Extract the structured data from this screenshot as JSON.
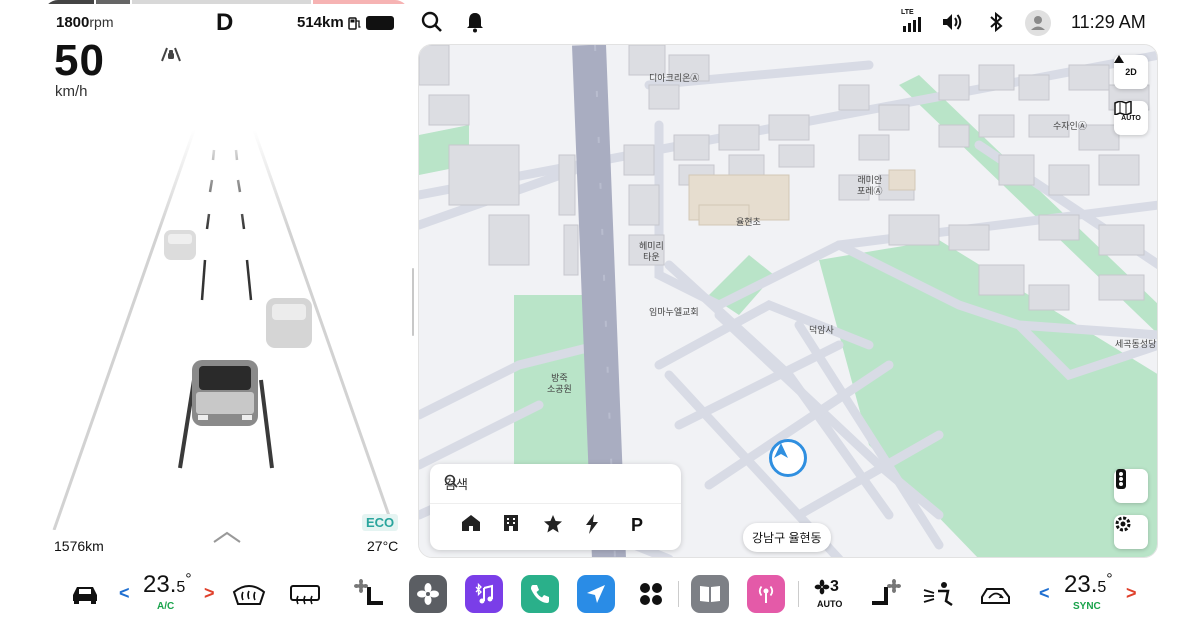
{
  "cluster": {
    "rpm_value": "1800",
    "rpm_unit": "rpm",
    "gear": "D",
    "range": "514km",
    "speed": "50",
    "speed_unit": "km/h",
    "odometer": "1576km",
    "drive_mode": "ECO",
    "outside_temp": "27°C",
    "icons": [
      "lane-assist-icon",
      "fuel-icon",
      "battery-icon",
      "chevron-up-icon"
    ]
  },
  "statusbar": {
    "time": "11:29 AM",
    "signal_label": "LTE",
    "icons": [
      "search-icon",
      "bell-icon",
      "signal-icon",
      "volume-icon",
      "bluetooth-icon",
      "user-avatar-icon"
    ]
  },
  "map": {
    "view_mode": "2D",
    "auto_label": "AUTO",
    "search_placeholder": "검색",
    "quick_destinations": [
      "home-icon",
      "building-icon",
      "star-icon",
      "charging-icon",
      "parking-icon"
    ],
    "parking_label": "P",
    "current_location": "강남구 율현동",
    "labels": {
      "l1": "디아크리온Ⓐ",
      "l2": "수자인Ⓐ",
      "l3": "래미안",
      "l3b": "포레Ⓐ",
      "l4": "율현초",
      "l5": "헤미리",
      "l5b": "타운",
      "l6": "임마누엘교회",
      "l7": "덕암사",
      "l8": "세곡동성당",
      "l9": "방죽",
      "l9b": "소공원"
    },
    "colors": {
      "park": "#b9e4c8",
      "road": "#d8dbe5",
      "main_road": "#a9adc1",
      "accent": "#2f8fe0"
    }
  },
  "dock": {
    "left_temp_whole": "23.",
    "left_temp_decimal": "5",
    "left_temp_degree": "°",
    "left_sub": "A/C",
    "right_temp_whole": "23.",
    "right_temp_decimal": "5",
    "right_temp_degree": "°",
    "right_sub": "SYNC",
    "fan_level": "3",
    "fan_mode": "AUTO",
    "items": [
      "car-icon",
      "front-defrost-icon",
      "rear-defrost-icon",
      "seat-fan-left-icon",
      "fan-app",
      "bluetooth-music-app",
      "phone-app",
      "navigation-app",
      "app-grid-icon",
      "manual-app",
      "radio-app",
      "fan-level-icon",
      "seat-fan-right-icon",
      "seat-heat-icon",
      "recirculation-icon"
    ],
    "colors": {
      "fan_tile": "#5b5e63",
      "music_tile": "#7a3ee8",
      "phone_tile": "#2ab08a",
      "nav_tile": "#2a8ce6",
      "manual_tile": "#7d8086",
      "radio_tile": "#e45aa8",
      "cool": "#1f6fd1",
      "warm": "#e0412c",
      "ac": "#19a34b"
    }
  }
}
